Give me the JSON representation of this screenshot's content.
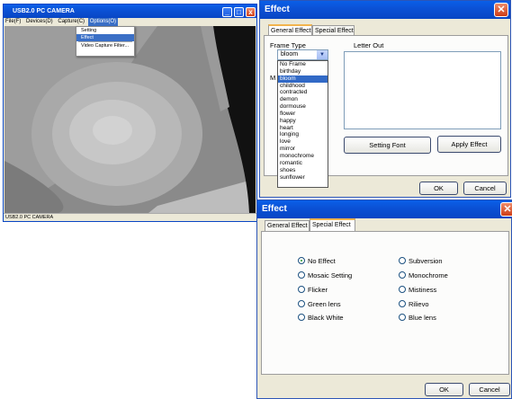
{
  "camera_window": {
    "title": "USB2.0 PC CAMERA",
    "menu": [
      "File(F)",
      "Devices(D)",
      "Capture(C)",
      "Options(O)"
    ],
    "options_menu": [
      "Setting",
      "Effect",
      "Video Capture Filter..."
    ],
    "status": "USB2.0 PC CAMERA"
  },
  "effect_dialog_1": {
    "title": "Effect",
    "close_glyph": "✕",
    "tabs": [
      "General Effect",
      "Special Effect"
    ],
    "frame_type_label": "Frame Type",
    "frame_selected": "bloom",
    "frame_options": [
      "No Frame",
      "birthday",
      "bloom",
      "childhood",
      "contracted",
      "demon",
      "dormouse",
      "flower",
      "happy",
      "heart",
      "longing",
      "love",
      "mirror",
      "monochrome",
      "romantic",
      "shoes",
      "sunflower"
    ],
    "letter_out_label": "Letter Out",
    "setting_font_button": "Setting Font",
    "apply_effect_button": "Apply Effect",
    "ok_button": "OK",
    "cancel_button": "Cancel",
    "hidden_label_fragment": "M"
  },
  "effect_dialog_2": {
    "title": "Effect",
    "close_glyph": "✕",
    "tabs": [
      "General Effect",
      "Special Effect"
    ],
    "effects_left": [
      "No Effect",
      "Mosaic Setting",
      "Flicker",
      "Green lens",
      "Black White"
    ],
    "effects_right": [
      "Subversion",
      "Monochrome",
      "Mistiness",
      "Rilievo",
      "Blue lens"
    ],
    "selected_effect": "No Effect",
    "ok_button": "OK",
    "cancel_button": "Cancel"
  },
  "colors": {
    "xp_title": "#0b52d6",
    "dialog_bg": "#ece9d8",
    "selection": "#3169c6",
    "tab_highlight": "#f2b44e"
  }
}
